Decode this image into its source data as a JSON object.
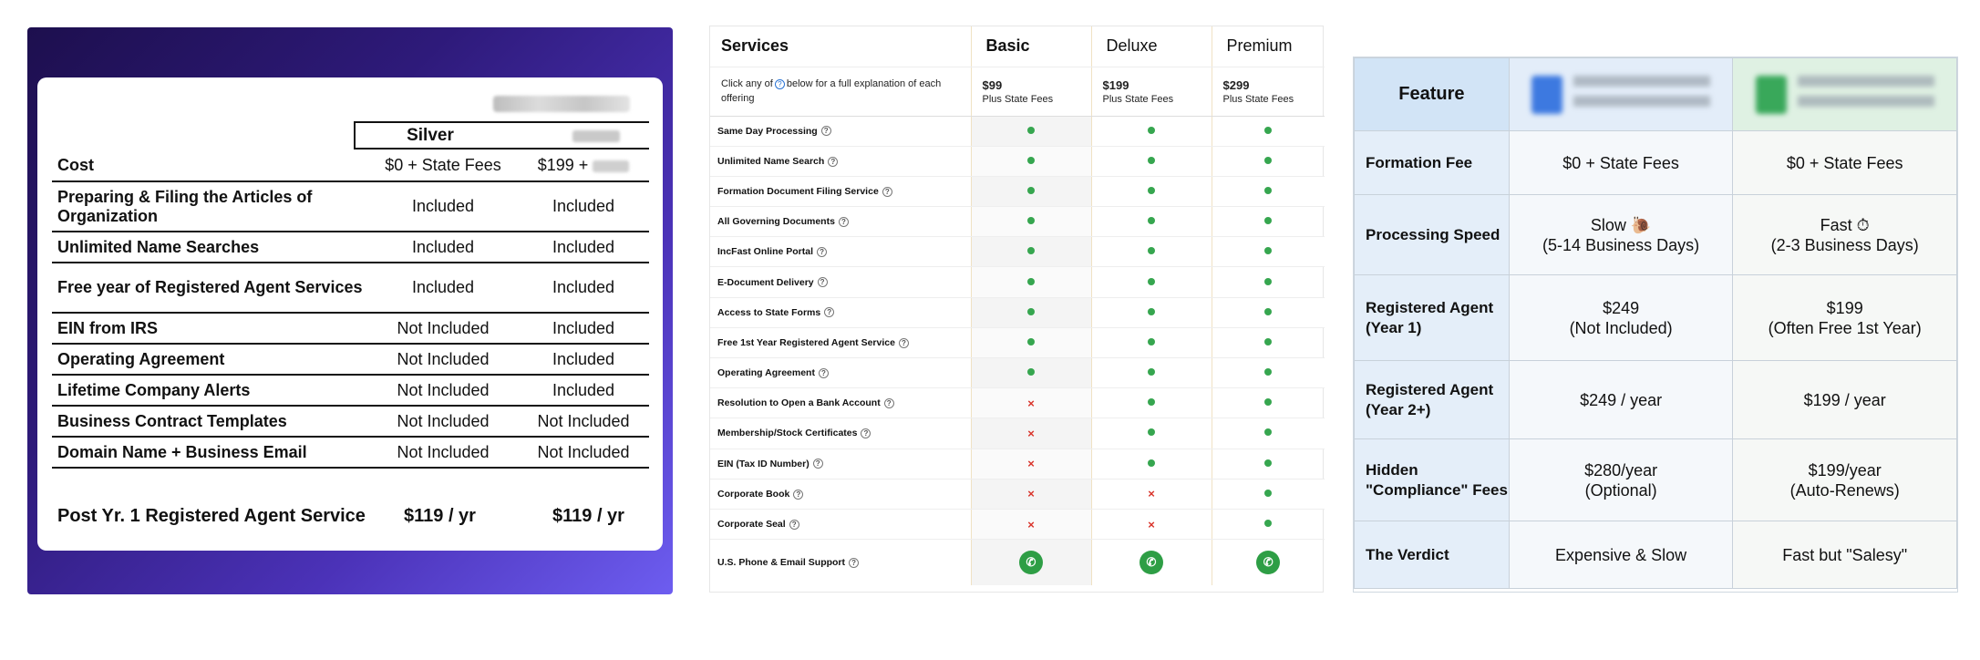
{
  "panel1": {
    "col1_header": "Silver",
    "rows": [
      {
        "label": "Cost",
        "c1": "$0 + State Fees",
        "c2": "$199 +"
      },
      {
        "label": "Preparing & Filing the Articles of Organization",
        "c1": "Included",
        "c2": "Included"
      },
      {
        "label": "Unlimited Name Searches",
        "c1": "Included",
        "c2": "Included"
      },
      {
        "label": "Free year of Registered Agent Services",
        "c1": "Included",
        "c2": "Included"
      },
      {
        "label": "EIN from IRS",
        "c1": "Not Included",
        "c2": "Included"
      },
      {
        "label": "Operating Agreement",
        "c1": "Not Included",
        "c2": "Included"
      },
      {
        "label": "Lifetime Company Alerts",
        "c1": "Not Included",
        "c2": "Included"
      },
      {
        "label": "Business Contract Templates",
        "c1": "Not Included",
        "c2": "Not Included"
      },
      {
        "label": "Domain Name + Business Email",
        "c1": "Not Included",
        "c2": "Not Included"
      }
    ],
    "footer": {
      "label": "Post Yr. 1 Registered Agent Service",
      "c1": "$119 / yr",
      "c2": "$119 / yr"
    }
  },
  "panel2": {
    "services_header": "Services",
    "plans": [
      "Basic",
      "Deluxe",
      "Premium"
    ],
    "prices": [
      "$99",
      "$199",
      "$299"
    ],
    "price_note": "Plus State Fees",
    "intro_a": "Click any of",
    "intro_b": "below for a full explanation of each offering",
    "rows": [
      {
        "name": "Same Day Processing",
        "marks": [
          "check",
          "check",
          "check"
        ]
      },
      {
        "name": "Unlimited Name Search",
        "marks": [
          "check",
          "check",
          "check"
        ]
      },
      {
        "name": "Formation Document Filing Service",
        "marks": [
          "check",
          "check",
          "check"
        ]
      },
      {
        "name": "All Governing Documents",
        "marks": [
          "check",
          "check",
          "check"
        ]
      },
      {
        "name": "IncFast Online Portal",
        "marks": [
          "check",
          "check",
          "check"
        ]
      },
      {
        "name": "E-Document Delivery",
        "marks": [
          "check",
          "check",
          "check"
        ]
      },
      {
        "name": "Access to State Forms",
        "marks": [
          "check",
          "check",
          "check"
        ]
      },
      {
        "name": "Free 1st Year Registered Agent Service",
        "marks": [
          "check",
          "check",
          "check"
        ]
      },
      {
        "name": "Operating Agreement",
        "marks": [
          "check",
          "check",
          "check"
        ]
      },
      {
        "name": "Resolution to Open a Bank Account",
        "marks": [
          "x",
          "check",
          "check"
        ]
      },
      {
        "name": "Membership/Stock Certificates",
        "marks": [
          "x",
          "check",
          "check"
        ]
      },
      {
        "name": "EIN (Tax ID Number)",
        "marks": [
          "x",
          "check",
          "check"
        ]
      },
      {
        "name": "Corporate Book",
        "marks": [
          "x",
          "x",
          "check"
        ]
      },
      {
        "name": "Corporate Seal",
        "marks": [
          "x",
          "x",
          "check"
        ]
      }
    ],
    "support_row": "U.S. Phone & Email Support",
    "colors": {
      "check": "#36a64f",
      "x": "#d9342b"
    }
  },
  "panel3": {
    "feature_header": "Feature",
    "rows": [
      {
        "label": "Formation Fee",
        "a": "$0 + State Fees",
        "b": "$0 + State Fees"
      },
      {
        "label": "Processing Speed",
        "a": "Slow 🐌\n(5-14 Business Days)",
        "b": "Fast ⏱\n(2-3 Business Days)"
      },
      {
        "label": "Registered Agent (Year 1)",
        "a": "$249\n(Not Included)",
        "b": "$199\n(Often Free 1st Year)"
      },
      {
        "label": "Registered Agent (Year 2+)",
        "a": "$249 / year",
        "b": "$199 / year"
      },
      {
        "label": "Hidden \"Compliance\" Fees",
        "a": "$280/year\n(Optional)",
        "b": "$199/year\n(Auto-Renews)"
      },
      {
        "label": "The Verdict",
        "a": "Expensive & Slow",
        "b": "Fast but \"Salesy\""
      }
    ]
  }
}
